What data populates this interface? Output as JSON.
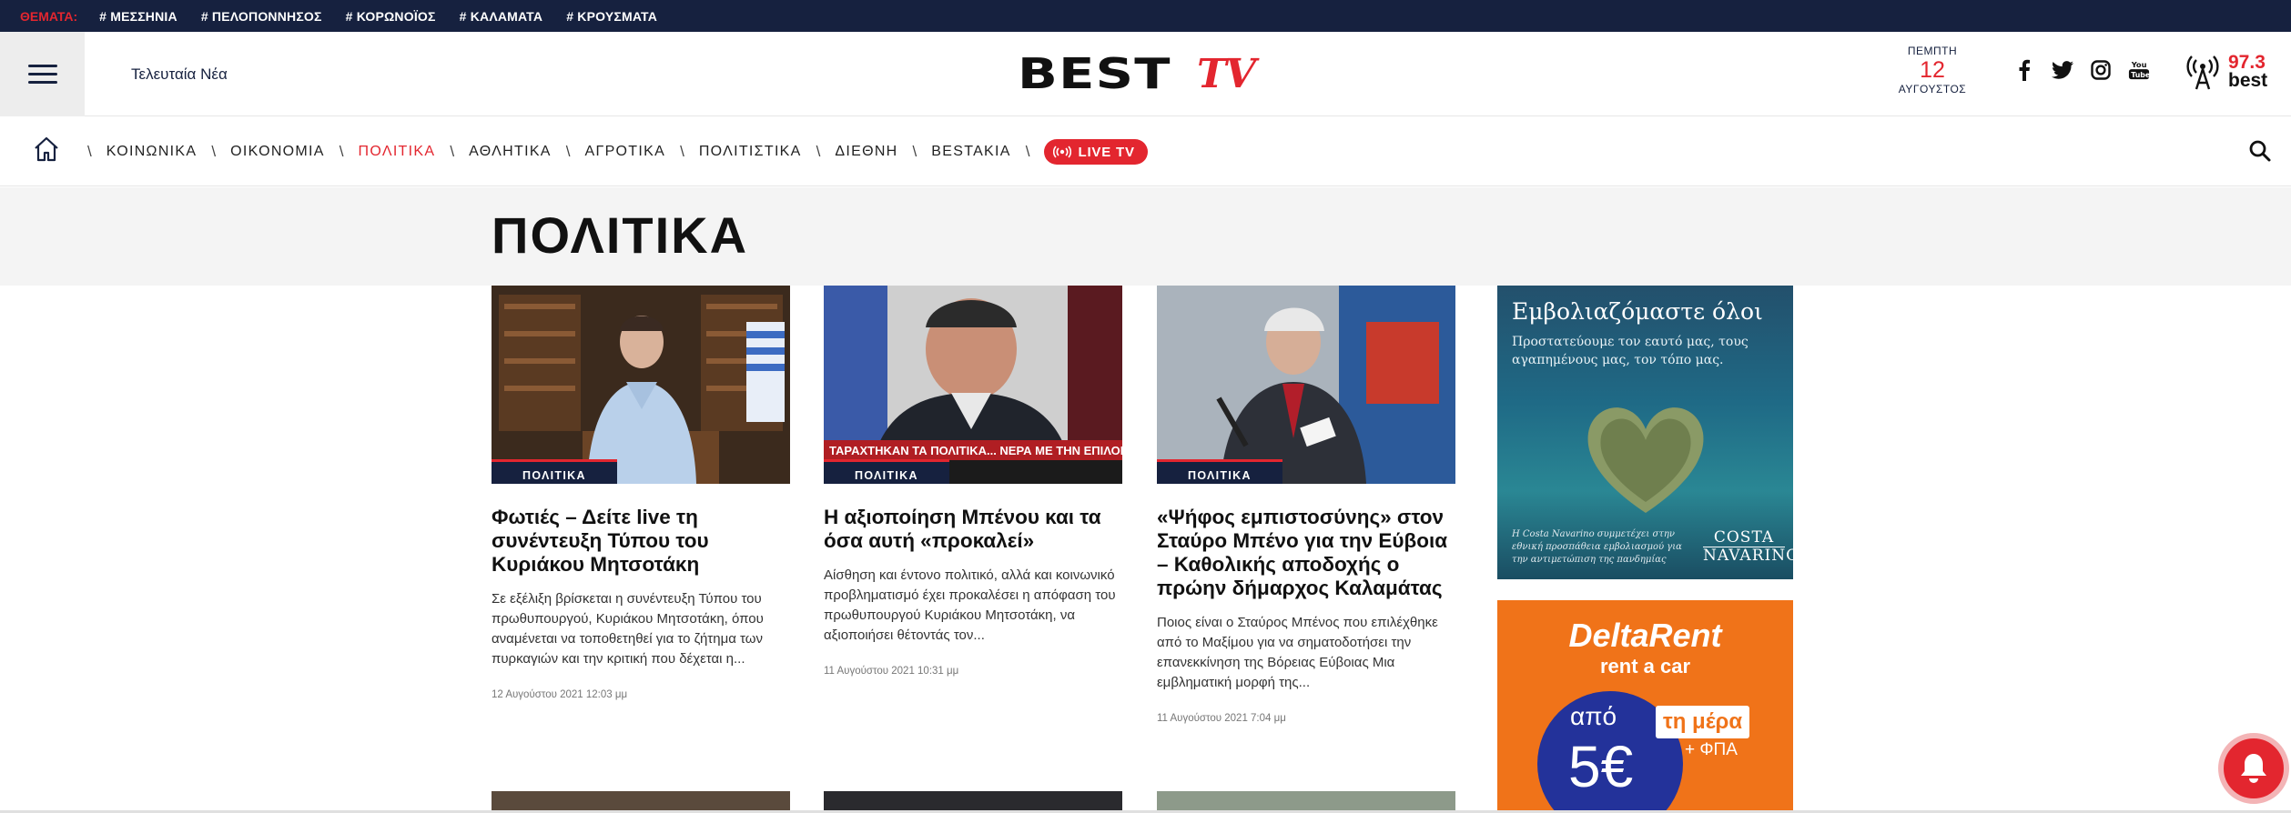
{
  "topbar": {
    "label": "ΘΕΜΑΤΑ:",
    "tags": [
      "# ΜΕΣΣΗΝΙΑ",
      "# ΠΕΛΟΠΟΝΝΗΣΟΣ",
      "# ΚΟΡΩΝΟΪΟΣ",
      "# ΚΑΛΑΜΑΤΑ",
      "# ΚΡΟΥΣΜΑΤΑ"
    ]
  },
  "header": {
    "latest_label": "Τελευταία Νέα",
    "logo_best": "BEST",
    "logo_tv": "TV",
    "date_day": "ΠΕΜΠΤΗ",
    "date_num": "12",
    "date_month": "ΑΥΓΟΥΣΤΟΣ",
    "social": [
      "facebook-icon",
      "twitter-icon",
      "instagram-icon",
      "youtube-icon"
    ],
    "radio_freq": "97.3",
    "radio_name": "best"
  },
  "nav": {
    "items": [
      "ΚΟΙΝΩΝΙΚΑ",
      "ΟΙΚΟΝΟΜΙΑ",
      "ΠΟΛΙΤΙΚΑ",
      "ΑΘΛΗΤΙΚΑ",
      "ΑΓΡΟΤΙΚΑ",
      "ΠΟΛΙΤΙΣΤΙΚΑ",
      "ΔΙΕΘΝΗ",
      "BESTAKIA"
    ],
    "active": "ΠΟΛΙΤΙΚΑ",
    "live_label": "LIVE TV"
  },
  "section": {
    "title": "ΠΟΛΙΤΙΚΑ"
  },
  "articles": [
    {
      "category": "ΠΟΛΙΤΙΚΑ",
      "title": "Φωτιές – Δείτε live τη συνέντευξη Τύπου του Κυριάκου Μητσοτάκη",
      "excerpt": "Σε εξέλιξη βρίσκεται η συνέντευξη Τύπου του πρωθυπουργού, Κυριάκου Μητσοτάκη, όπου αναμένεται να τοποθετηθεί για το ζήτημα των πυρκαγιών και την κριτική που δέχεται η...",
      "time": "12 Αυγούστου 2021 12:03 μμ"
    },
    {
      "category": "ΠΟΛΙΤΙΚΑ",
      "title": "Η αξιοποίηση Μπένου και τα όσα αυτή «προκαλεί»",
      "excerpt": "Αίσθηση και έντονο πολιτικό, αλλά και κοινωνικό προβληματισμό έχει προκαλέσει η απόφαση του πρωθυπουργού Κυριάκου Μητσοτάκη, να αξιοποιήσει θέτοντάς τον...",
      "time": "11 Αυγούστου 2021 10:31 μμ",
      "image_caption": "ΤΑΡΑΧΤΗΚΑΝ ΤΑ ΠΟΛΙΤΙΚΑ... ΝΕΡΑ ΜΕ ΤΗΝ ΕΠΙΛΟΓΗ ΜΠΕ"
    },
    {
      "category": "ΠΟΛΙΤΙΚΑ",
      "title": "«Ψήφος εμπιστοσύνης» στον Σταύρο Μπένο για την Εύβοια – Καθολικής αποδοχής ο πρώην δήμαρχος Καλαμάτας",
      "excerpt": "Ποιος είναι ο Σταύρος Μπένος που επιλέχθηκε από το Μαξίμου για να σηματοδοτήσει την επανεκκίνηση της Βόρειας Εύβοιας Μια εμβληματική μορφή της...",
      "time": "11 Αυγούστου 2021 7:04 μμ"
    }
  ],
  "ads": {
    "costa": {
      "headline": "Εμβολιαζόμαστε όλοι",
      "sub": "Προστατεύουμε τον εαυτό μας, τους αγαπημένους μας, τον τόπο μας.",
      "fine": "Η Costa Navarino συμμετέχει στην εθνική προσπάθεια εμβολιασμού για την αντιμετώπιση της πανδημίας",
      "brand_line1": "COSTA",
      "brand_line2": "NAVARINO"
    },
    "deltarent": {
      "brand": "DeltaRent",
      "sub": "rent a car",
      "apo": "από",
      "price": "5€",
      "perday": "τη μέρα",
      "vat": "+ ΦΠΑ"
    }
  },
  "colors": {
    "navy": "#16213f",
    "accent": "#e3262f",
    "ad_orange": "#f07319"
  }
}
